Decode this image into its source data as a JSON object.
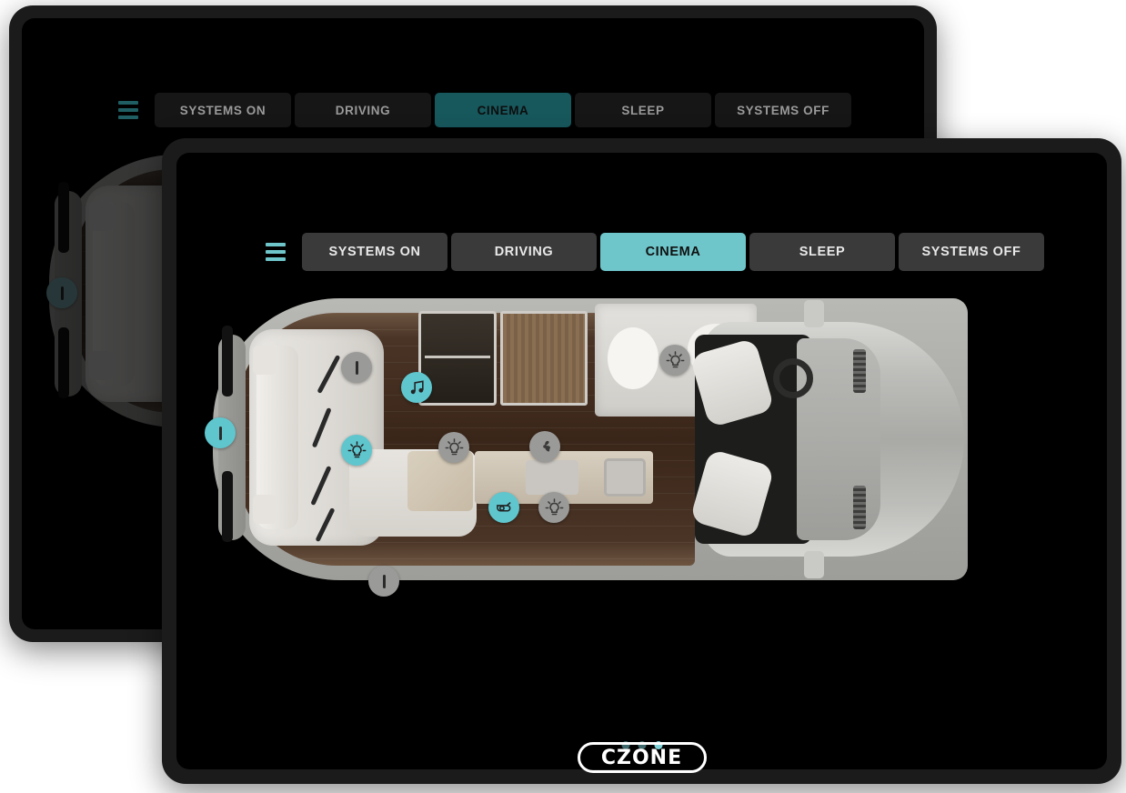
{
  "app": {
    "brand": "CZONE",
    "accent_on": "#5fc6ce",
    "accent_off": "#9a9a98",
    "tab_active_bg": "#6ec6cb",
    "tab_inactive_bg": "#3a3a3a",
    "screen_bg": "#000000",
    "bezel": "#1b1b1b"
  },
  "front_device": {
    "menu_icon": "hamburger-icon",
    "tabs": [
      {
        "label": "SYSTEMS ON",
        "active": false
      },
      {
        "label": "DRIVING",
        "active": false
      },
      {
        "label": "CINEMA",
        "active": true
      },
      {
        "label": "SLEEP",
        "active": false
      },
      {
        "label": "SYSTEMS OFF",
        "active": false
      }
    ],
    "pagination": {
      "count": 3,
      "active_index": 2
    },
    "controls": [
      {
        "name": "lounge-power-left",
        "icon": "power-bar-icon",
        "state": "on"
      },
      {
        "name": "lounge-power-upper",
        "icon": "power-bar-icon",
        "state": "off"
      },
      {
        "name": "audio-music",
        "icon": "music-note-icon",
        "state": "on"
      },
      {
        "name": "lounge-light",
        "icon": "light-bulb-icon",
        "state": "on"
      },
      {
        "name": "galley-ceiling-light",
        "icon": "light-bulb-icon",
        "state": "off"
      },
      {
        "name": "bathroom-light",
        "icon": "light-bulb-icon",
        "state": "off"
      },
      {
        "name": "ventilation-fan",
        "icon": "fan-icon",
        "state": "off"
      },
      {
        "name": "water-pump",
        "icon": "water-pump-icon",
        "state": "on"
      },
      {
        "name": "galley-task-light",
        "icon": "light-bulb-icon",
        "state": "off"
      },
      {
        "name": "exterior-power",
        "icon": "power-bar-icon",
        "state": "off"
      }
    ]
  },
  "back_device": {
    "menu_icon": "hamburger-icon",
    "tabs": [
      {
        "label": "SYSTEMS ON",
        "active": false
      },
      {
        "label": "DRIVING",
        "active": false
      },
      {
        "label": "CINEMA",
        "active": true
      },
      {
        "label": "SLEEP",
        "active": false
      },
      {
        "label": "SYSTEMS OFF",
        "active": false
      }
    ],
    "controls": [
      {
        "name": "lounge-power-left",
        "icon": "power-bar-icon",
        "state": "on"
      }
    ]
  }
}
